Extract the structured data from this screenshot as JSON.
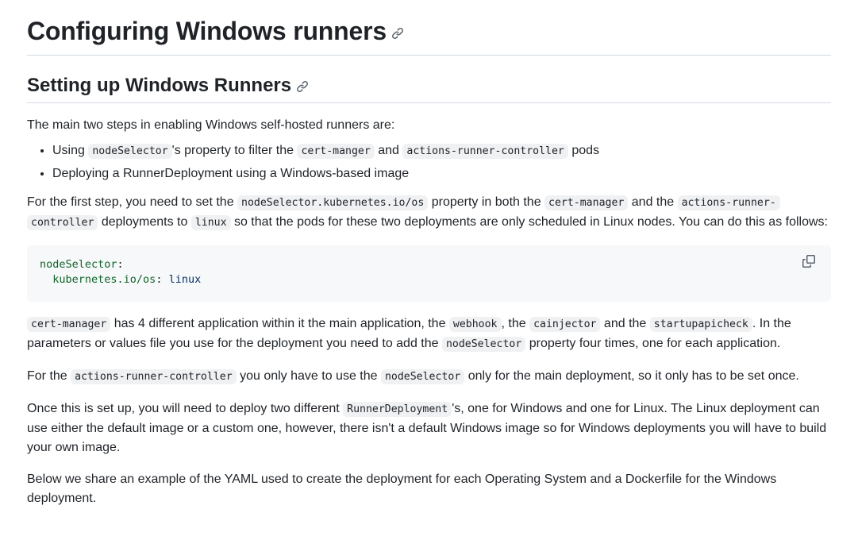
{
  "h1": "Configuring Windows runners",
  "h2": "Setting up Windows Runners",
  "intro": "The main two steps in enabling Windows self-hosted runners are:",
  "bullets": {
    "b1_a": "Using ",
    "b1_code1": "nodeSelector",
    "b1_b": "'s property to filter the ",
    "b1_code2": "cert-manger",
    "b1_c": " and ",
    "b1_code3": "actions-runner-controller",
    "b1_d": " pods",
    "b2": "Deploying a RunnerDeployment using a Windows-based image"
  },
  "p2": {
    "a": "For the first step, you need to set the ",
    "code1": "nodeSelector.kubernetes.io/os",
    "b": " property in both the ",
    "code2": "cert-manager",
    "c": " and the ",
    "code3a": "actions-runner-",
    "code3b": "controller",
    "d": " deployments to ",
    "code4": "linux",
    "e": " so that the pods for these two deployments are only scheduled in Linux nodes. You can do this as follows:"
  },
  "codeblock": {
    "line1_key": "nodeSelector",
    "line1_colon": ":",
    "line2_indent": "  ",
    "line2_key": "kubernetes.io/os",
    "line2_colon": ": ",
    "line2_val": "linux",
    "copy_icon": "copy-icon"
  },
  "p3": {
    "code1": "cert-manager",
    "a": " has 4 different application within it the main application, the ",
    "code2": "webhook",
    "b": ", the ",
    "code3": "cainjector",
    "c": " and the ",
    "code4": "startupapicheck",
    "d": ". In the parameters or values file you use for the deployment you need to add the ",
    "code5": "nodeSelector",
    "e": " property four times, one for each application."
  },
  "p4": {
    "a": "For the ",
    "code1": "actions-runner-controller",
    "b": " you only have to use the ",
    "code2": "nodeSelector",
    "c": " only for the main deployment, so it only has to be set once."
  },
  "p5": {
    "a": "Once this is set up, you will need to deploy two different ",
    "code1": "RunnerDeployment",
    "b": "'s, one for Windows and one for Linux. The Linux deployment can use either the default image or a custom one, however, there isn't a default Windows image so for Windows deployments you will have to build your own image."
  },
  "p6": "Below we share an example of the YAML used to create the deployment for each Operating System and a Dockerfile for the Windows deployment.",
  "colors": {
    "text": "#1f2328",
    "border": "#d1d9e0",
    "code_bg": "#eff1f3",
    "block_bg": "#f6f8fa",
    "yaml_key": "#116329",
    "yaml_val": "#0a3069",
    "icon": "#59636e"
  }
}
